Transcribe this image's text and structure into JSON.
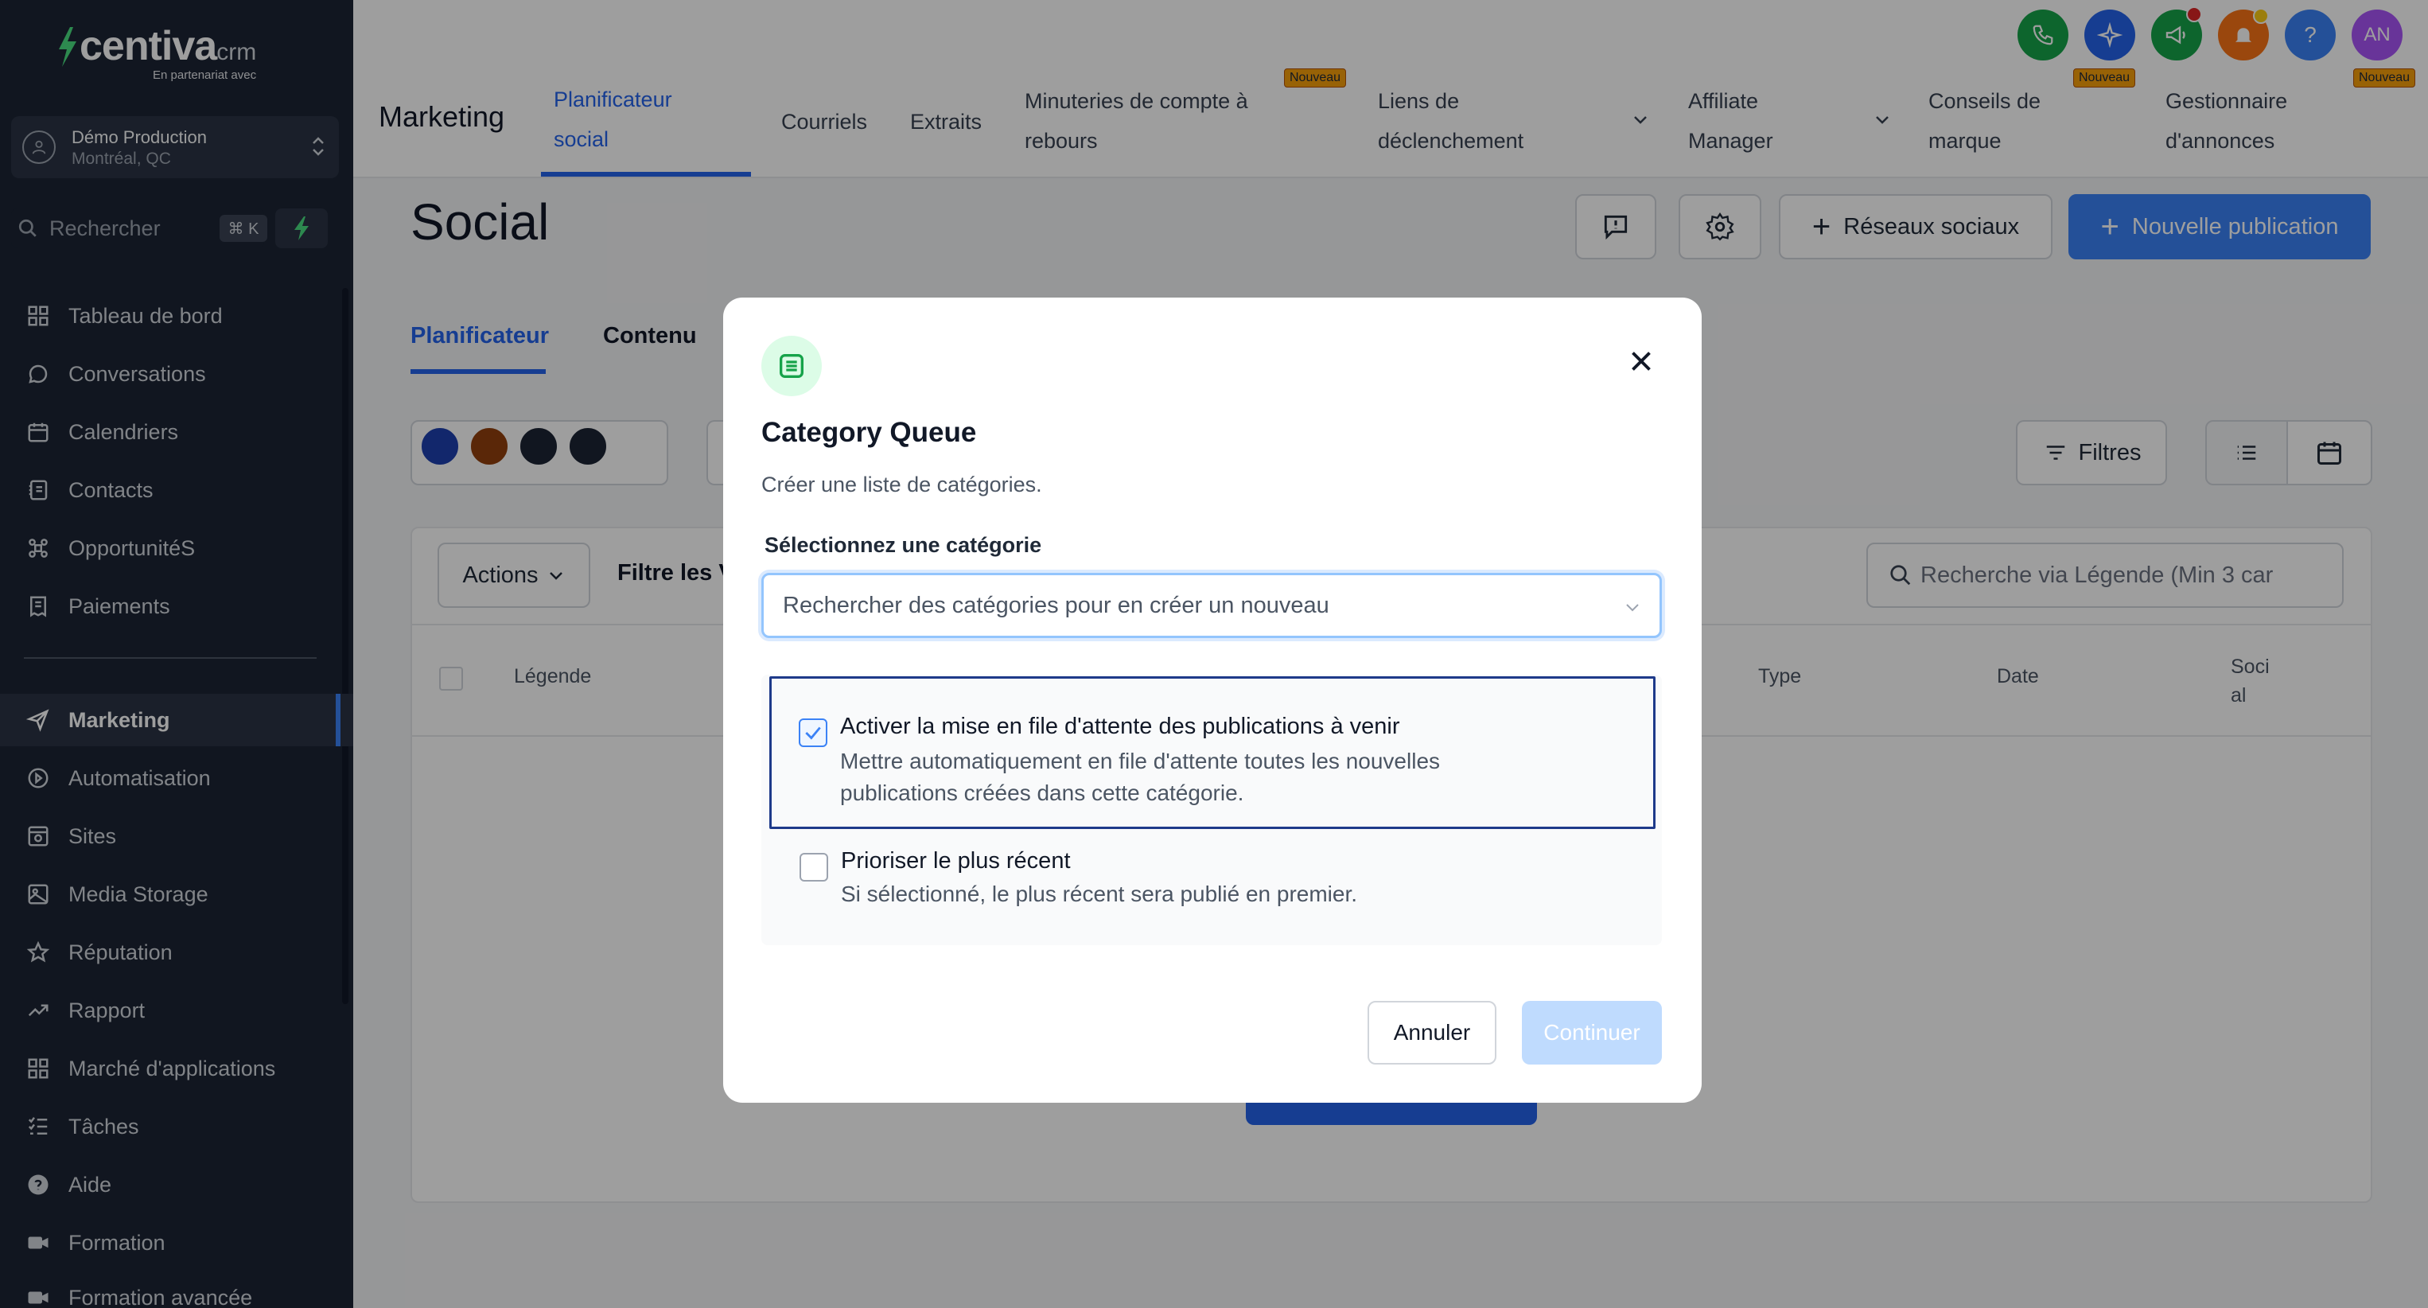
{
  "brand": {
    "name": "centiva",
    "suffix": "crm",
    "tagline": "En partenariat avec"
  },
  "account": {
    "name": "Démo Production",
    "location": "Montréal, QC"
  },
  "sidebar_search": {
    "placeholder": "Rechercher",
    "shortcut": "⌘ K"
  },
  "sidebar": {
    "items": [
      {
        "label": "Tableau de bord",
        "icon": "dashboard-icon"
      },
      {
        "label": "Conversations",
        "icon": "chat-icon"
      },
      {
        "label": "Calendriers",
        "icon": "calendar-icon"
      },
      {
        "label": "Contacts",
        "icon": "contacts-icon"
      },
      {
        "label": "OpportunitéS",
        "icon": "opportunities-icon"
      },
      {
        "label": "Paiements",
        "icon": "payments-icon"
      },
      {
        "label": "Marketing",
        "icon": "send-icon",
        "active": true
      },
      {
        "label": "Automatisation",
        "icon": "automation-icon"
      },
      {
        "label": "Sites",
        "icon": "sites-icon"
      },
      {
        "label": "Media Storage",
        "icon": "media-icon"
      },
      {
        "label": "Réputation",
        "icon": "star-icon"
      },
      {
        "label": "Rapport",
        "icon": "chart-icon"
      },
      {
        "label": "Marché d'applications",
        "icon": "apps-icon"
      },
      {
        "label": "Tâches",
        "icon": "tasks-icon"
      },
      {
        "label": "Aide",
        "icon": "help-icon"
      },
      {
        "label": "Formation",
        "icon": "video-icon"
      },
      {
        "label": "Formation avancée",
        "icon": "video-icon"
      }
    ]
  },
  "header": {
    "section": "Marketing",
    "tabs": {
      "social_1": "Planificateur",
      "social_2": "social",
      "emails": "Courriels",
      "snippets": "Extraits",
      "countdown_1": "Minuteries de compte à",
      "countdown_2": "rebours",
      "trigger_1": "Liens de",
      "trigger_2": "déclenchement",
      "affiliate_1": "Affiliate",
      "affiliate_2": "Manager",
      "brand_1": "Conseils de",
      "brand_2": "marque",
      "ads_1": "Gestionnaire",
      "ads_2": "d'annonces"
    },
    "new_badge": "Nouveau",
    "user_initials": "AN",
    "help_glyph": "?"
  },
  "page": {
    "title": "Social",
    "social_networks_btn": "Réseaux sociaux",
    "new_post_btn": "Nouvelle publication",
    "subtab_planner": "Planificateur",
    "subtab_content": "Contenu",
    "filters_btn": "Filtres",
    "actions_btn": "Actions",
    "filter_text": "Filtre les V",
    "caption_search_placeholder": "Recherche via Légende (Min 3 car",
    "columns": {
      "caption": "Légende",
      "type": "Type",
      "date": "Date",
      "social_1": "Soci",
      "social_2": "al"
    }
  },
  "modal": {
    "title": "Category Queue",
    "description": "Créer une liste de catégories.",
    "field_label": "Sélectionnez une catégorie",
    "select_placeholder": "Rechercher des catégories pour en créer un nouveau",
    "option1_title": "Activer la mise en file d'attente des publications à venir",
    "option1_desc_1": "Mettre automatiquement en file d'attente toutes les nouvelles",
    "option1_desc_2": "publications créées dans cette catégorie.",
    "option1_checked": true,
    "option2_title": "Prioriser le plus récent",
    "option2_desc": "Si sélectionné, le plus récent sera publié en premier.",
    "option2_checked": false,
    "cancel": "Annuler",
    "continue": "Continuer"
  },
  "colors": {
    "sidebar": "#1c2434",
    "accent": "#3b82f6",
    "badge": "#f59e0b"
  }
}
